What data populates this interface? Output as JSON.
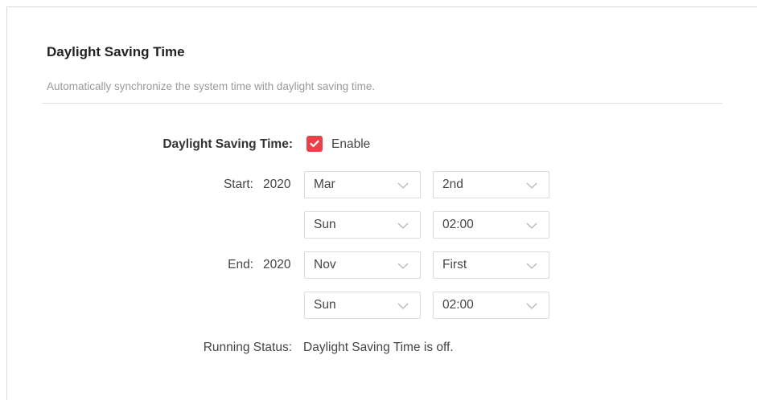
{
  "section": {
    "title": "Daylight Saving Time",
    "description": "Automatically synchronize the system time with daylight saving time."
  },
  "dst": {
    "label": "Daylight Saving Time:",
    "enable_label": "Enable",
    "enabled": true
  },
  "start": {
    "label": "Start:",
    "year": "2020",
    "month": "Mar",
    "week": "2nd",
    "day": "Sun",
    "time": "02:00"
  },
  "end": {
    "label": "End:",
    "year": "2020",
    "month": "Nov",
    "week": "First",
    "day": "Sun",
    "time": "02:00"
  },
  "status": {
    "label": "Running Status:",
    "value": "Daylight Saving Time is off."
  },
  "colors": {
    "accent": "#e7424a",
    "muted_text": "#999999"
  },
  "icons": {
    "checkbox": "check-icon",
    "dropdown": "chevron-down-icon"
  }
}
